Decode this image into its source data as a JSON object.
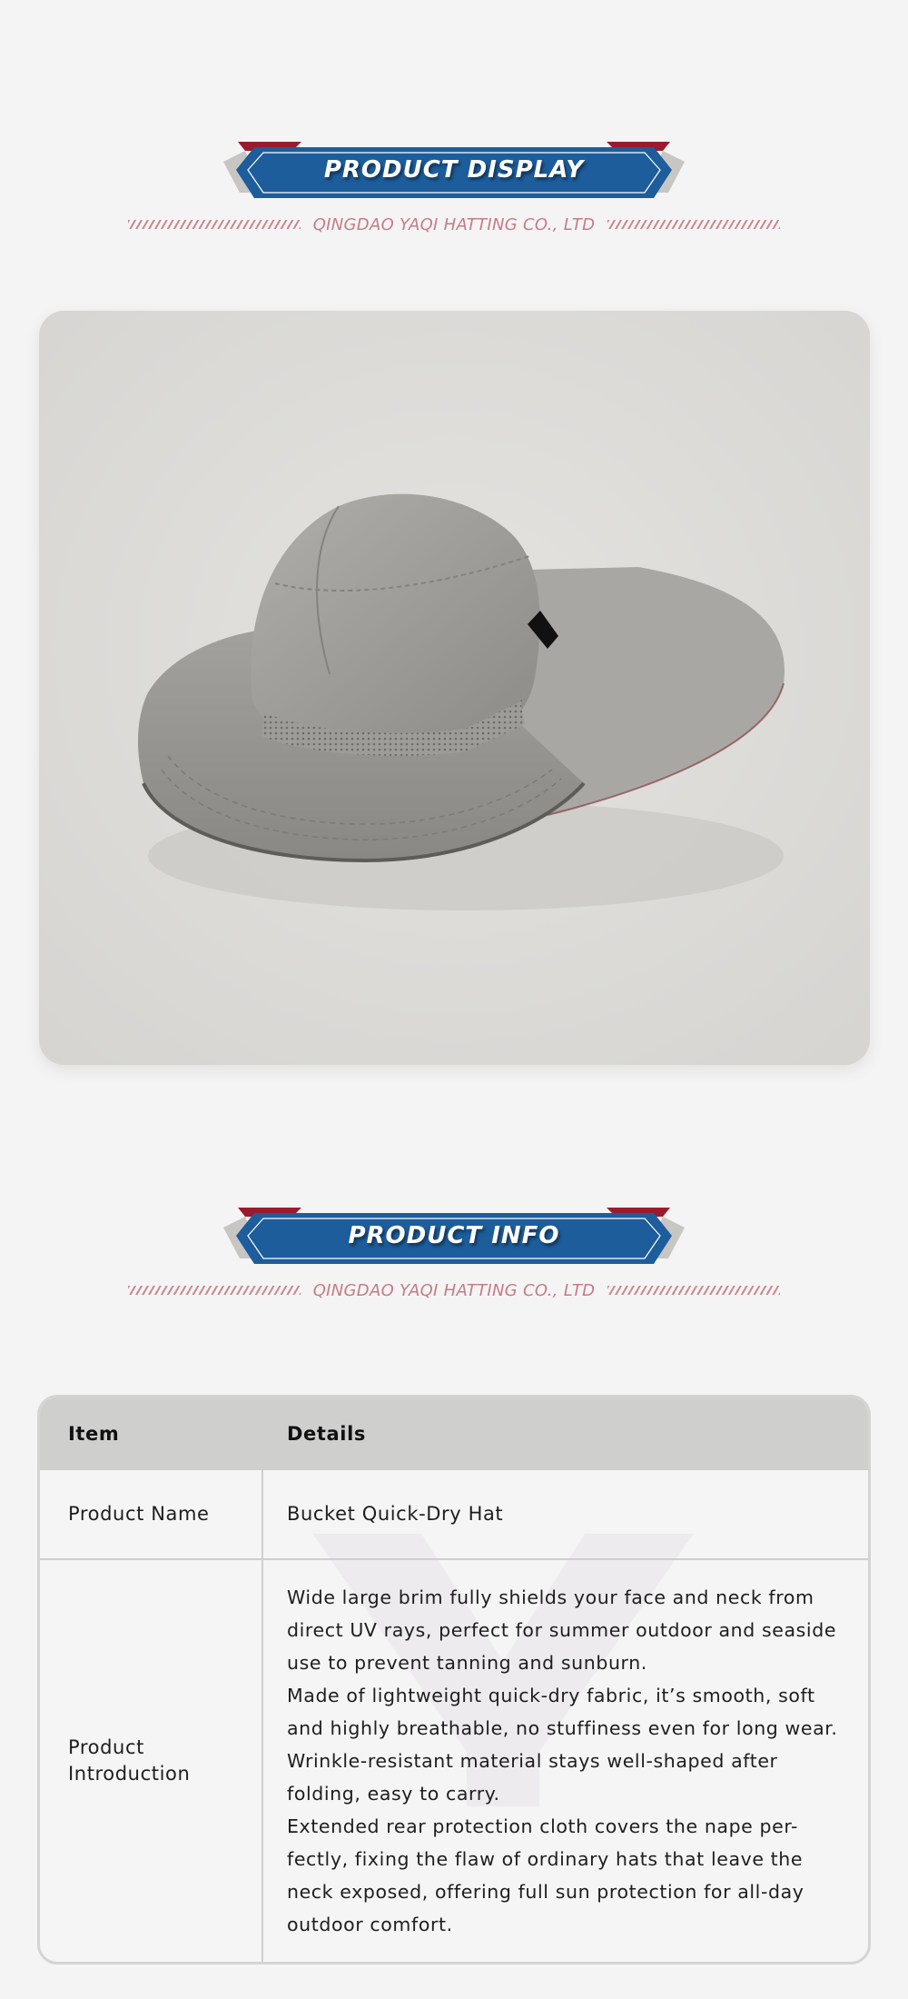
{
  "sections": {
    "display": {
      "title": "PRODUCT DISPLAY",
      "company": "QINGDAO YAQI HATTING CO., LTD"
    },
    "info": {
      "title": "PRODUCT INFO",
      "company": "QINGDAO YAQI HATTING CO., LTD"
    }
  },
  "product_image": {
    "subject": "grey bucket hat with rear neck flap"
  },
  "table": {
    "headers": {
      "item": "Item",
      "details": "Details"
    },
    "rows": [
      {
        "item": "Product Name",
        "details": "Bucket Quick-Dry Hat"
      },
      {
        "item_line1": "Product",
        "item_line2": "Introduction",
        "paragraphs": [
          "Wide large brim fully shields your face and neck from direct UV rays, perfect for summer outdoor and seaside use to prevent tanning and sunburn.",
          "Made of lightweight quick-dry fabric, it’s smooth, soft and highly breathable, no stuffiness even for long wear. Wrinkle-resistant material stays well-shaped after folding, easy to carry.",
          "Extended rear protection cloth covers the nape per-fectly, fixing the flaw of ordinary hats that leave the neck exposed, offering full sun protection for all-day outdoor comfort."
        ]
      }
    ]
  },
  "colors": {
    "banner_blue": "#1d5d9b",
    "banner_red": "#9b1b2e",
    "banner_grey": "#c8c6c2",
    "accent_pink": "#c47c86",
    "page_bg": "#f4f4f4",
    "header_row": "#cfcfcd"
  }
}
